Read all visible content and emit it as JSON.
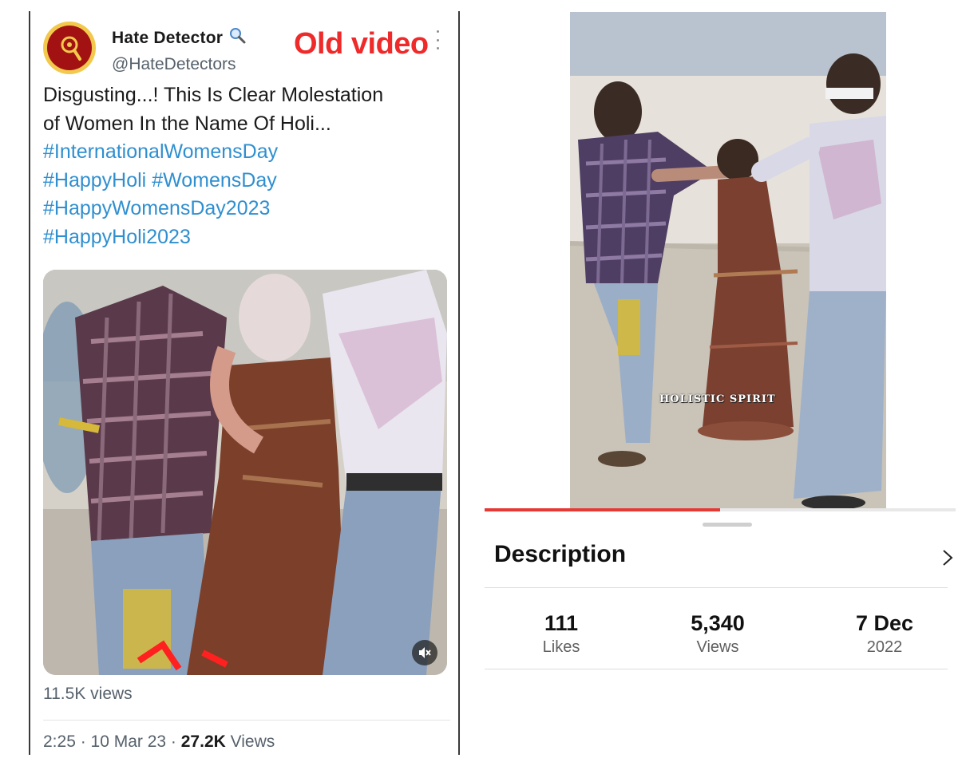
{
  "tweet": {
    "display_name": "Hate Detector",
    "name_icon": "magnifier-icon",
    "handle": "@HateDetectors",
    "overlay_label": "Old video",
    "text_line1": "Disgusting...! This Is Clear Molestation",
    "text_line2": "of Women In the Name Of Holi...",
    "hashtags": [
      "#InternationalWomensDay",
      "#HappyHoli",
      "#WomensDay",
      "#HappyWomensDay2023",
      "#HappyHoli2023"
    ],
    "media_views": "11.5K views",
    "time": "2:25 · 10 Mar 23 · ",
    "views_count": "27.2K",
    "views_label": " Views",
    "colors": {
      "accent_red": "#ee2a2a",
      "hashtag_blue": "#2f8fd0"
    }
  },
  "video": {
    "watermark": "HOLISTIC SPIRIT",
    "progress_fraction": 0.5,
    "description_title": "Description",
    "stats": [
      {
        "value": "111",
        "label": "Likes"
      },
      {
        "value": "5,340",
        "label": "Views"
      },
      {
        "value": "7 Dec",
        "label": "2022"
      }
    ],
    "colors": {
      "progress": "#e53935"
    }
  }
}
